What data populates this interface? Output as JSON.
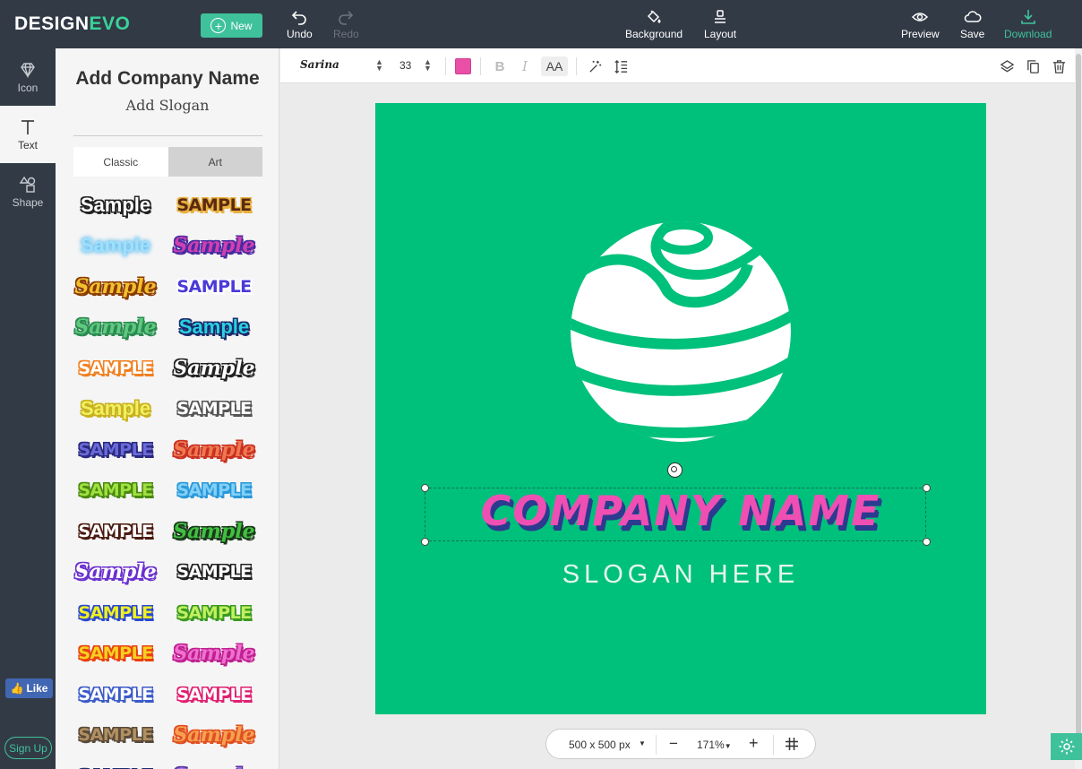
{
  "app": {
    "logo_design": "DESIGN",
    "logo_evo": "EVO"
  },
  "topbar": {
    "new_label": "New",
    "undo_label": "Undo",
    "redo_label": "Redo",
    "background_label": "Background",
    "layout_label": "Layout",
    "preview_label": "Preview",
    "save_label": "Save",
    "download_label": "Download"
  },
  "rail": {
    "icon_label": "Icon",
    "text_label": "Text",
    "shape_label": "Shape",
    "like_label": "Like",
    "signup_label": "Sign Up"
  },
  "panel": {
    "add_company": "Add Company Name",
    "add_slogan": "Add Slogan",
    "tabs": [
      {
        "label": "Classic",
        "active": true
      },
      {
        "label": "Art",
        "active": false
      }
    ],
    "samples": [
      {
        "text": "Sample",
        "color": "#ffffff",
        "stroke": "#222222",
        "style": "plain"
      },
      {
        "text": "SAMPLE",
        "color": "#5a2a10",
        "stroke": "#e8b040",
        "style": "caps"
      },
      {
        "text": "Sample",
        "color": "#9fe0ff",
        "stroke": "#5ab8ea",
        "style": "glow"
      },
      {
        "text": "Sample",
        "color": "#d040b0",
        "stroke": "#4a2aa0",
        "style": "script"
      },
      {
        "text": "Sample",
        "color": "#f0c030",
        "stroke": "#8a3a00",
        "style": "script"
      },
      {
        "text": "SAMPLE",
        "color": "#4a3ad8",
        "stroke": "#ffffff",
        "style": "caps"
      },
      {
        "text": "Sample",
        "color": "#60c880",
        "stroke": "#2a8a50",
        "style": "script"
      },
      {
        "text": "Sample",
        "color": "#2ad0e0",
        "stroke": "#1a2a6a",
        "style": "plain"
      },
      {
        "text": "SAMPLE",
        "color": "#ffffff",
        "stroke": "#f08020",
        "style": "caps"
      },
      {
        "text": "Sample",
        "color": "#ffffff",
        "stroke": "#222222",
        "style": "script"
      },
      {
        "text": "Sample",
        "color": "#f0f060",
        "stroke": "#c8b020",
        "style": "plain"
      },
      {
        "text": "SAMPLE",
        "color": "#ffffff",
        "stroke": "#555555",
        "style": "caps"
      },
      {
        "text": "SAMPLE",
        "color": "#6a6ad8",
        "stroke": "#2a2a80",
        "style": "caps"
      },
      {
        "text": "Sample",
        "color": "#f07850",
        "stroke": "#c83020",
        "style": "script"
      },
      {
        "text": "SAMPLE",
        "color": "#a0e040",
        "stroke": "#4a8a10",
        "style": "caps"
      },
      {
        "text": "SAMPLE",
        "color": "#80d0f8",
        "stroke": "#2a98d8",
        "style": "caps"
      },
      {
        "text": "SAMPLE",
        "color": "#ffffff",
        "stroke": "#4a1a10",
        "style": "caps"
      },
      {
        "text": "Sample",
        "color": "#40c040",
        "stroke": "#1a3a1a",
        "style": "script"
      },
      {
        "text": "Sample",
        "color": "#ffffff",
        "stroke": "#6a30d0",
        "style": "script"
      },
      {
        "text": "SAMPLE",
        "color": "#ffffff",
        "stroke": "#222222",
        "style": "caps"
      },
      {
        "text": "SAMPLE",
        "color": "#f0f020",
        "stroke": "#2a4ad0",
        "style": "caps"
      },
      {
        "text": "SAMPLE",
        "color": "#c0f060",
        "stroke": "#3a9a20",
        "style": "caps"
      },
      {
        "text": "SAMPLE",
        "color": "#f8d020",
        "stroke": "#e84010",
        "style": "caps"
      },
      {
        "text": "Sample",
        "color": "#f070d0",
        "stroke": "#c02090",
        "style": "script"
      },
      {
        "text": "SAMPLE",
        "color": "#ffffff",
        "stroke": "#3a5ac8",
        "style": "caps"
      },
      {
        "text": "SAMPLE",
        "color": "#ffffff",
        "stroke": "#e02070",
        "style": "caps"
      },
      {
        "text": "SAMPLE",
        "color": "#b09060",
        "stroke": "#5a4a3a",
        "style": "caps"
      },
      {
        "text": "Sample",
        "color": "#f8a050",
        "stroke": "#e05020",
        "style": "script"
      },
      {
        "text": "SAMPLE",
        "color": "#3a4ab0",
        "stroke": "#1a2a70",
        "style": "caps"
      },
      {
        "text": "Sample",
        "color": "#a070e0",
        "stroke": "#5030a0",
        "style": "script"
      }
    ]
  },
  "toolbar": {
    "font_name": "Sarina",
    "font_size": "33",
    "text_color": "#ea4fa8",
    "bold_label": "B",
    "italic_label": "I",
    "aa_label": "AA"
  },
  "canvas": {
    "background": "#00c17b",
    "company_name": "COMPANY NAME",
    "slogan": "SLOGAN HERE"
  },
  "zoombar": {
    "size_label": "500 x 500 px",
    "zoom_label": "171%"
  }
}
